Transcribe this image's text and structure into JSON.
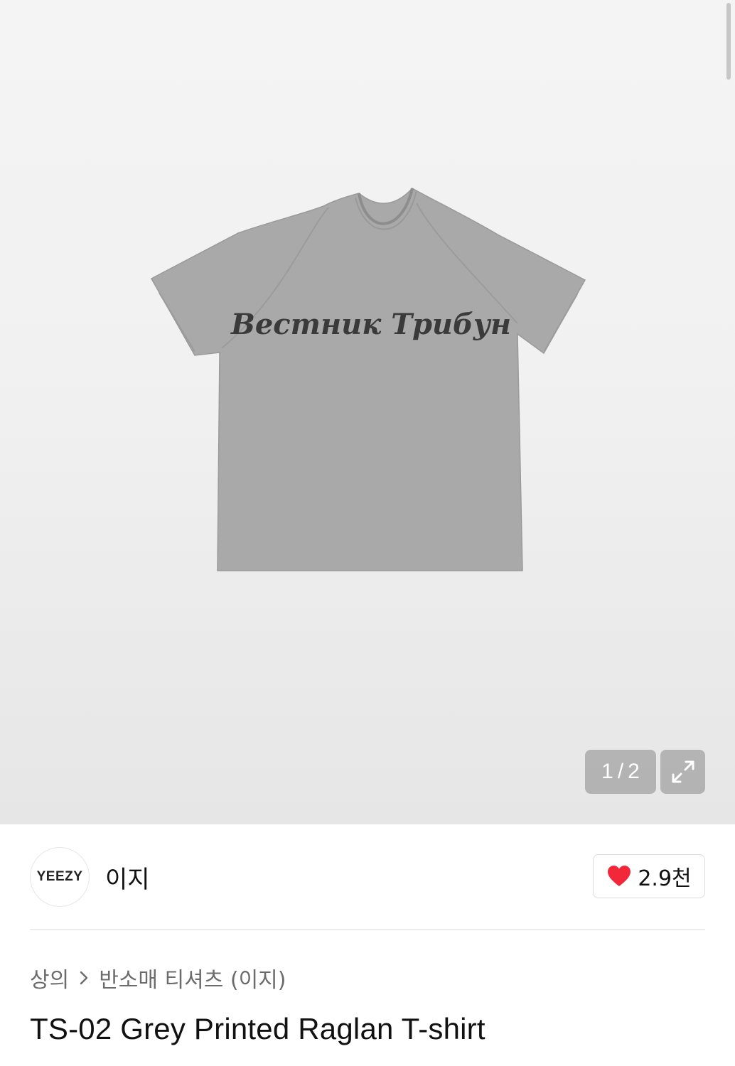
{
  "gallery": {
    "current_page": "1",
    "separator": "/",
    "total_pages": "2",
    "print_text": "Вестник Трибун",
    "shirt_color": "#a9a8a8"
  },
  "brand": {
    "logo_text": "YEEZY",
    "name": "이지"
  },
  "like": {
    "count": "2.9천",
    "heart_color": "#f2283a"
  },
  "breadcrumb": {
    "items": [
      "상의",
      "반소매 티셔츠 (이지)"
    ]
  },
  "product": {
    "title": "TS-02 Grey Printed Raglan T-shirt"
  }
}
